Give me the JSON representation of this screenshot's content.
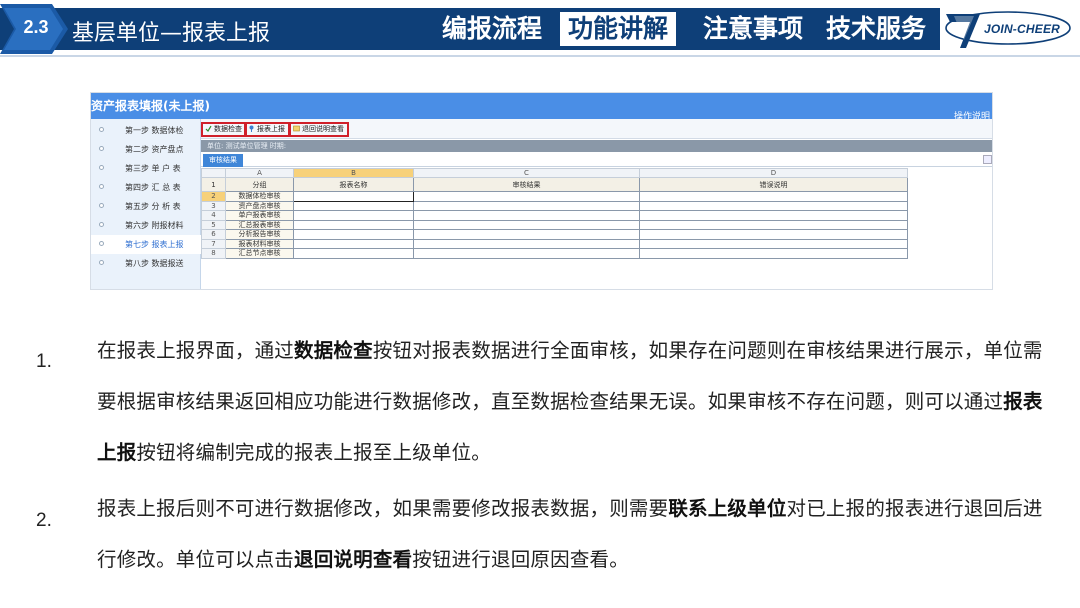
{
  "header": {
    "section_number": "2.3",
    "section_title": "基层单位—报表上报",
    "tabs": [
      {
        "label": "编报流程",
        "active": false
      },
      {
        "label": "功能讲解",
        "active": true
      },
      {
        "label": "注意事项",
        "active": false
      },
      {
        "label": "技术服务",
        "active": false
      }
    ],
    "logo_text": "JOIN-CHEER",
    "colors": {
      "brand": "#0e3f78",
      "active_tab_bg": "#ffffff"
    }
  },
  "screenshot": {
    "window_title": "资产报表填报(未上报)",
    "help_link": "操作说明",
    "steps": [
      {
        "label": "第一步 数据体检",
        "active": false
      },
      {
        "label": "第二步 资产盘点",
        "active": false
      },
      {
        "label": "第三步 单 户 表",
        "active": false
      },
      {
        "label": "第四步 汇 总 表",
        "active": false
      },
      {
        "label": "第五步 分 析 表",
        "active": false
      },
      {
        "label": "第六步 附报材料",
        "active": false
      },
      {
        "label": "第七步 报表上报",
        "active": true
      },
      {
        "label": "第八步 数据报送",
        "active": false
      }
    ],
    "toolbar": {
      "check_label": "数据检查",
      "report_label": "报表上报",
      "return_label": "退回说明查看"
    },
    "unit_text": "单位:  测试单位管理  时期:",
    "results_tab": "审核结果",
    "column_letters": [
      "A",
      "B",
      "C",
      "D"
    ],
    "headers": [
      "分组",
      "报表名称",
      "审核结果",
      "错误说明"
    ],
    "rows": [
      {
        "n": "2",
        "group": "数据体检审核"
      },
      {
        "n": "3",
        "group": "资产盘点审核"
      },
      {
        "n": "4",
        "group": "单户报表审核"
      },
      {
        "n": "5",
        "group": "汇总报表审核"
      },
      {
        "n": "6",
        "group": "分析报告审核"
      },
      {
        "n": "7",
        "group": "报表材料审核"
      },
      {
        "n": "8",
        "group": "汇总节点审核"
      }
    ],
    "header_row_number": "1"
  },
  "body": {
    "items": [
      {
        "number": "1.",
        "segments": [
          {
            "t": "在报表上报界面，通过",
            "b": false
          },
          {
            "t": "数据检查",
            "b": true
          },
          {
            "t": "按钮对报表数据进行全面审核，如果存在问题则在审核结果进行展示，单位需要根据审核结果返回相应功能进行数据修改，直至数据检查结果无误。如果审核不存在问题，则可以通过",
            "b": false
          },
          {
            "t": "报表上报",
            "b": true
          },
          {
            "t": "按钮将编制完成的报表上报至上级单位。",
            "b": false
          }
        ]
      },
      {
        "number": "2.",
        "segments": [
          {
            "t": "报表上报后则不可进行数据修改，如果需要修改报表数据，则需要",
            "b": false
          },
          {
            "t": "联系上级单位",
            "b": true
          },
          {
            "t": "对已上报的报表进行退回后进行修改。单位可以点击",
            "b": false
          },
          {
            "t": "退回说明查看",
            "b": true
          },
          {
            "t": "按钮进行退回原因查看。",
            "b": false
          }
        ]
      }
    ]
  }
}
